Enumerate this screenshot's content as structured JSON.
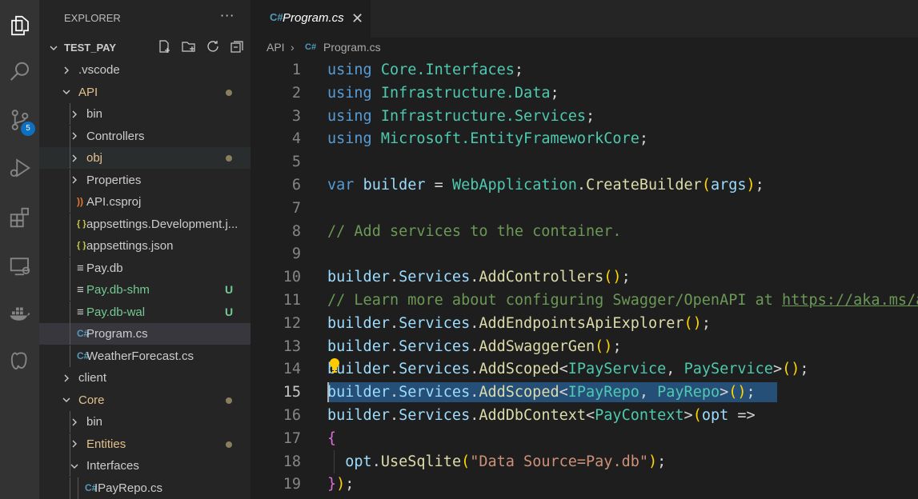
{
  "explorer": {
    "header": "EXPLORER",
    "more": "···",
    "root": "TEST_PAY",
    "items": [
      {
        "label": ".vscode",
        "type": "folder",
        "open": false
      },
      {
        "label": "API",
        "type": "folder",
        "open": true,
        "color": "#e2c08d",
        "status": "dot"
      },
      {
        "label": "bin",
        "type": "folder",
        "open": false
      },
      {
        "label": "Controllers",
        "type": "folder",
        "open": false
      },
      {
        "label": "obj",
        "type": "folder",
        "open": false,
        "color": "#e2c08d",
        "status": "dot"
      },
      {
        "label": "Properties",
        "type": "folder",
        "open": false
      },
      {
        "label": "API.csproj",
        "type": "file",
        "icon": "rss-icon"
      },
      {
        "label": "appsettings.Development.j...",
        "type": "file",
        "icon": "json-icon"
      },
      {
        "label": "appsettings.json",
        "type": "file",
        "icon": "json-icon"
      },
      {
        "label": "Pay.db",
        "type": "file",
        "icon": "lines-icon"
      },
      {
        "label": "Pay.db-shm",
        "type": "file",
        "icon": "lines-icon",
        "color": "#73c991",
        "status": "U"
      },
      {
        "label": "Pay.db-wal",
        "type": "file",
        "icon": "lines-icon",
        "color": "#73c991",
        "status": "U"
      },
      {
        "label": "Program.cs",
        "type": "file",
        "icon": "csharp-icon"
      },
      {
        "label": "WeatherForecast.cs",
        "type": "file",
        "icon": "csharp-icon"
      },
      {
        "label": "client",
        "type": "folder",
        "open": false
      },
      {
        "label": "Core",
        "type": "folder",
        "open": true,
        "color": "#e2c08d",
        "status": "dot"
      },
      {
        "label": "bin",
        "type": "folder",
        "open": false
      },
      {
        "label": "Entities",
        "type": "folder",
        "open": false,
        "color": "#e2c08d",
        "status": "dot"
      },
      {
        "label": "Interfaces",
        "type": "folder",
        "open": true
      },
      {
        "label": "IPayRepo.cs",
        "type": "file",
        "icon": "csharp-icon"
      }
    ],
    "icon_glyphs": {
      "rss-icon": "))",
      "json-icon": "{ }",
      "lines-icon": "≡",
      "csharp-icon": "C#"
    }
  },
  "activity_bar": {
    "scm_badge": "5",
    "icons": [
      "files-icon",
      "search-icon",
      "source-control-icon",
      "run-debug-icon",
      "extensions-icon",
      "remote-explorer-icon",
      "docker-icon",
      "database-icon"
    ]
  },
  "tab": {
    "icon": "C#",
    "title": "Program.cs",
    "close": "✕"
  },
  "breadcrumb": {
    "items": [
      "API",
      "Program.cs"
    ],
    "sep": "›",
    "file_icon": "C#"
  },
  "editor": {
    "active_line": 15,
    "lines": [
      {
        "n": "1",
        "tokens": [
          [
            "kw",
            "using"
          ],
          [
            "pn",
            " "
          ],
          [
            "ns",
            "Core.Interfaces"
          ],
          [
            "pn",
            ";"
          ]
        ]
      },
      {
        "n": "2",
        "tokens": [
          [
            "kw",
            "using"
          ],
          [
            "pn",
            " "
          ],
          [
            "ns",
            "Infrastructure.Data"
          ],
          [
            "pn",
            ";"
          ]
        ]
      },
      {
        "n": "3",
        "tokens": [
          [
            "kw",
            "using"
          ],
          [
            "pn",
            " "
          ],
          [
            "ns",
            "Infrastructure.Services"
          ],
          [
            "pn",
            ";"
          ]
        ]
      },
      {
        "n": "4",
        "tokens": [
          [
            "kw",
            "using"
          ],
          [
            "pn",
            " "
          ],
          [
            "ns",
            "Microsoft.EntityFrameworkCore"
          ],
          [
            "pn",
            ";"
          ]
        ]
      },
      {
        "n": "5",
        "tokens": []
      },
      {
        "n": "6",
        "tokens": [
          [
            "kw",
            "var"
          ],
          [
            "pn",
            " "
          ],
          [
            "var",
            "builder"
          ],
          [
            "pn",
            " = "
          ],
          [
            "ns",
            "WebApplication"
          ],
          [
            "pn",
            "."
          ],
          [
            "fn",
            "CreateBuilder"
          ],
          [
            "br",
            "("
          ],
          [
            "var",
            "args"
          ],
          [
            "br",
            ")"
          ],
          [
            "pn",
            ";"
          ]
        ]
      },
      {
        "n": "7",
        "tokens": []
      },
      {
        "n": "8",
        "tokens": [
          [
            "cm",
            "// Add services to the container."
          ]
        ]
      },
      {
        "n": "9",
        "tokens": []
      },
      {
        "n": "10",
        "tokens": [
          [
            "var",
            "builder"
          ],
          [
            "pn",
            "."
          ],
          [
            "var",
            "Services"
          ],
          [
            "pn",
            "."
          ],
          [
            "fn",
            "AddControllers"
          ],
          [
            "br",
            "()"
          ],
          [
            "pn",
            ";"
          ]
        ]
      },
      {
        "n": "11",
        "tokens": [
          [
            "cm",
            "// Learn more about configuring Swagger/OpenAPI at "
          ],
          [
            "link",
            "https://aka.ms/aspnetcore/swashbuckle"
          ]
        ]
      },
      {
        "n": "12",
        "tokens": [
          [
            "var",
            "builder"
          ],
          [
            "pn",
            "."
          ],
          [
            "var",
            "Services"
          ],
          [
            "pn",
            "."
          ],
          [
            "fn",
            "AddEndpointsApiExplorer"
          ],
          [
            "br",
            "()"
          ],
          [
            "pn",
            ";"
          ]
        ]
      },
      {
        "n": "13",
        "tokens": [
          [
            "var",
            "builder"
          ],
          [
            "pn",
            "."
          ],
          [
            "var",
            "Services"
          ],
          [
            "pn",
            "."
          ],
          [
            "fn",
            "AddSwaggerGen"
          ],
          [
            "br",
            "()"
          ],
          [
            "pn",
            ";"
          ]
        ]
      },
      {
        "n": "14",
        "tokens": [
          [
            "var",
            "builder"
          ],
          [
            "pn",
            "."
          ],
          [
            "var",
            "Services"
          ],
          [
            "pn",
            "."
          ],
          [
            "fn",
            "AddScoped"
          ],
          [
            "pn",
            "<"
          ],
          [
            "ns",
            "IPayService"
          ],
          [
            "pn",
            ", "
          ],
          [
            "ns",
            "PayService"
          ],
          [
            "pn",
            ">"
          ],
          [
            "br",
            "()"
          ],
          [
            "pn",
            ";"
          ]
        ]
      },
      {
        "n": "15",
        "tokens": [
          [
            "var",
            "builder"
          ],
          [
            "pn",
            "."
          ],
          [
            "var",
            "Services"
          ],
          [
            "pn",
            "."
          ],
          [
            "fn",
            "AddScoped"
          ],
          [
            "pn",
            "<"
          ],
          [
            "ns",
            "IPayRepo"
          ],
          [
            "pn",
            ", "
          ],
          [
            "ns",
            "PayRepo"
          ],
          [
            "pn",
            ">"
          ],
          [
            "br",
            "()"
          ],
          [
            "pn",
            ";"
          ]
        ]
      },
      {
        "n": "16",
        "tokens": [
          [
            "var",
            "builder"
          ],
          [
            "pn",
            "."
          ],
          [
            "var",
            "Services"
          ],
          [
            "pn",
            "."
          ],
          [
            "fn",
            "AddDbContext"
          ],
          [
            "pn",
            "<"
          ],
          [
            "ns",
            "PayContext"
          ],
          [
            "pn",
            ">"
          ],
          [
            "br",
            "("
          ],
          [
            "var",
            "opt"
          ],
          [
            "pn",
            " =>"
          ]
        ]
      },
      {
        "n": "17",
        "tokens": [
          [
            "br2",
            "{"
          ]
        ]
      },
      {
        "n": "18",
        "tokens": [
          [
            "pn",
            "  "
          ],
          [
            "var",
            "opt"
          ],
          [
            "pn",
            "."
          ],
          [
            "fn",
            "UseSqlite"
          ],
          [
            "br",
            "("
          ],
          [
            "str",
            "\"Data Source=Pay.db\""
          ],
          [
            "br",
            ")"
          ],
          [
            "pn",
            ";"
          ]
        ]
      },
      {
        "n": "19",
        "tokens": [
          [
            "br2",
            "}"
          ],
          [
            "br",
            ")"
          ],
          [
            "pn",
            ";"
          ]
        ]
      }
    ]
  }
}
